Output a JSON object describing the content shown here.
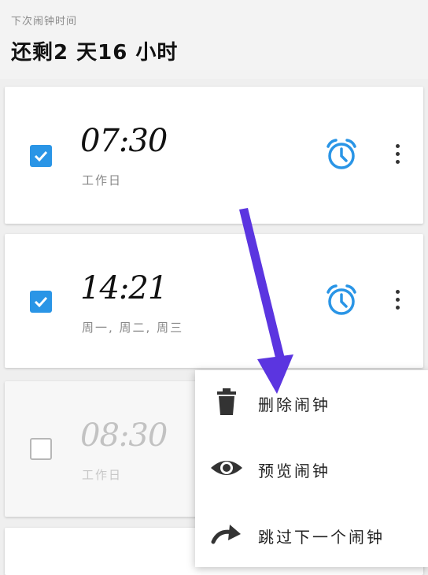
{
  "header": {
    "next_alarm_label": "下次闹钟时间",
    "remaining_text": "还剩2 天16 小时"
  },
  "alarms": [
    {
      "time": "07:30",
      "repeat": "工作日",
      "enabled": true,
      "icon": "alarm-clock-icon"
    },
    {
      "time": "14:21",
      "repeat": "周一, 周二, 周三",
      "enabled": true,
      "icon": "alarm-clock-icon"
    },
    {
      "time": "08:30",
      "repeat": "工作日",
      "enabled": false
    }
  ],
  "context_menu": {
    "items": [
      {
        "label": "删除闹钟",
        "icon": "trash-icon"
      },
      {
        "label": "预览闹钟",
        "icon": "eye-icon"
      },
      {
        "label": "跳过下一个闹钟",
        "icon": "skip-arrow-icon"
      }
    ]
  },
  "colors": {
    "accent": "#2a95e6",
    "annotation_arrow": "#5b35e0",
    "background": "#efefef"
  }
}
